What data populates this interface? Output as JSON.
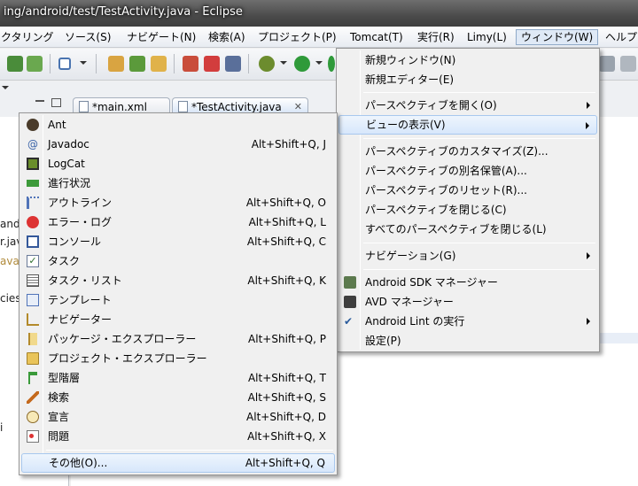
{
  "window": {
    "title": "ing/android/test/TestActivity.java - Eclipse"
  },
  "menubar": [
    {
      "label": "クタリング"
    },
    {
      "label": "ソース(S)"
    },
    {
      "label": "ナビゲート(N)"
    },
    {
      "label": "検索(A)"
    },
    {
      "label": "プロジェクト(P)"
    },
    {
      "label": "Tomcat(T)"
    },
    {
      "label": "実行(R)"
    },
    {
      "label": "Limy(L)"
    },
    {
      "label": "ウィンドウ(W)"
    },
    {
      "label": "ヘルプ"
    }
  ],
  "tabs": [
    {
      "label": "*main.xml"
    },
    {
      "label": "*TestActivity.java"
    }
  ],
  "left_panel": {
    "lines": [
      "andr",
      "r.jav",
      "ava",
      "cies",
      "i"
    ]
  },
  "window_menu": [
    {
      "label": "新規ウィンドウ(N)"
    },
    {
      "label": "新規エディター(E)"
    },
    {
      "label": "パースペクティブを開く(O)"
    },
    {
      "label": "ビューの表示(V)"
    },
    {
      "label": "パースペクティブのカスタマイズ(Z)..."
    },
    {
      "label": "パースペクティブの別名保管(A)..."
    },
    {
      "label": "パースペクティブのリセット(R)..."
    },
    {
      "label": "パースペクティブを閉じる(C)"
    },
    {
      "label": "すべてのパースペクティブを閉じる(L)"
    },
    {
      "label": "ナビゲーション(G)"
    },
    {
      "label": "Android SDK マネージャー"
    },
    {
      "label": "AVD マネージャー"
    },
    {
      "label": "Android Lint の実行"
    },
    {
      "label": "設定(P)"
    }
  ],
  "show_view_menu": [
    {
      "label": "Ant",
      "accel": ""
    },
    {
      "label": "Javadoc",
      "accel": "Alt+Shift+Q, J"
    },
    {
      "label": "LogCat",
      "accel": ""
    },
    {
      "label": "進行状況",
      "accel": ""
    },
    {
      "label": "アウトライン",
      "accel": "Alt+Shift+Q, O"
    },
    {
      "label": "エラー・ログ",
      "accel": "Alt+Shift+Q, L"
    },
    {
      "label": "コンソール",
      "accel": "Alt+Shift+Q, C"
    },
    {
      "label": "タスク",
      "accel": ""
    },
    {
      "label": "タスク・リスト",
      "accel": "Alt+Shift+Q, K"
    },
    {
      "label": "テンプレート",
      "accel": ""
    },
    {
      "label": "ナビゲーター",
      "accel": ""
    },
    {
      "label": "パッケージ・エクスプローラー",
      "accel": "Alt+Shift+Q, P"
    },
    {
      "label": "プロジェクト・エクスプローラー",
      "accel": ""
    },
    {
      "label": "型階層",
      "accel": "Alt+Shift+Q, T"
    },
    {
      "label": "検索",
      "accel": "Alt+Shift+Q, S"
    },
    {
      "label": "宣言",
      "accel": "Alt+Shift+Q, D"
    },
    {
      "label": "問題",
      "accel": "Alt+Shift+Q, X"
    },
    {
      "label": "その他(O)...",
      "accel": "Alt+Shift+Q, Q"
    }
  ]
}
